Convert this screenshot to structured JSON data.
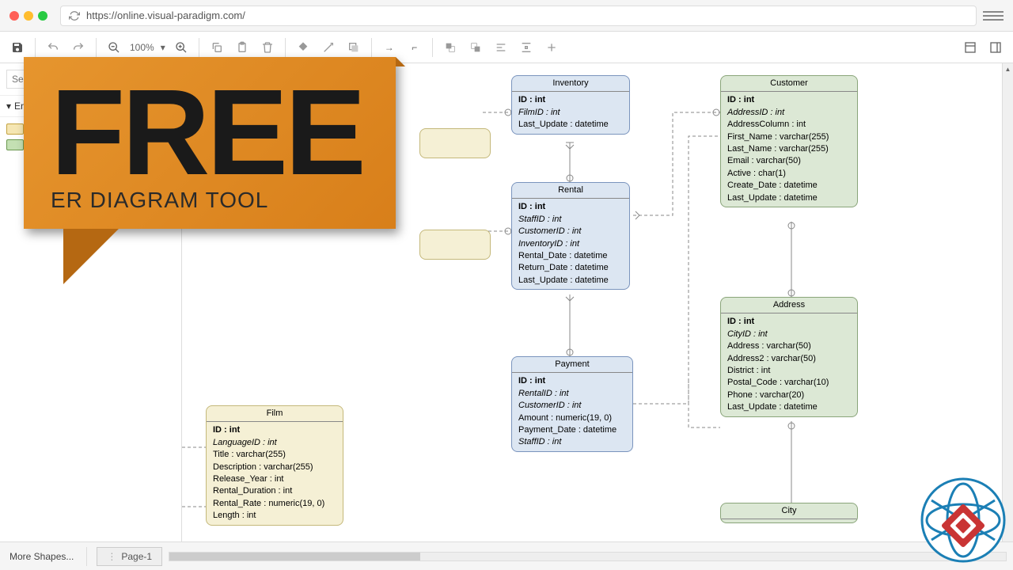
{
  "browser": {
    "url": "https://online.visual-paradigm.com/"
  },
  "toolbar": {
    "zoom": "100%"
  },
  "sidebar": {
    "search_placeholder": "Se",
    "section": "En",
    "more_shapes": "More Shapes..."
  },
  "page_tab": "Page-1",
  "banner": {
    "title": "FREE",
    "subtitle": "ER DIAGRAM TOOL"
  },
  "entities": {
    "inventory": {
      "title": "Inventory",
      "rows": [
        {
          "text": "ID : int",
          "pk": true
        },
        {
          "text": "FilmID : int",
          "fk": true
        },
        {
          "text": "Last_Update : datetime"
        }
      ]
    },
    "customer": {
      "title": "Customer",
      "rows": [
        {
          "text": "ID : int",
          "pk": true
        },
        {
          "text": "AddressID : int",
          "fk": true
        },
        {
          "text": "AddressColumn : int"
        },
        {
          "text": "First_Name : varchar(255)"
        },
        {
          "text": "Last_Name : varchar(255)"
        },
        {
          "text": "Email : varchar(50)"
        },
        {
          "text": "Active : char(1)"
        },
        {
          "text": "Create_Date : datetime"
        },
        {
          "text": "Last_Update : datetime"
        }
      ]
    },
    "rental": {
      "title": "Rental",
      "rows": [
        {
          "text": "ID : int",
          "pk": true
        },
        {
          "text": "StaffID : int",
          "fk": true
        },
        {
          "text": "CustomerID : int",
          "fk": true
        },
        {
          "text": "InventoryID : int",
          "fk": true
        },
        {
          "text": "Rental_Date : datetime"
        },
        {
          "text": "Return_Date : datetime"
        },
        {
          "text": "Last_Update : datetime"
        }
      ]
    },
    "address": {
      "title": "Address",
      "rows": [
        {
          "text": "ID : int",
          "pk": true
        },
        {
          "text": "CityID : int",
          "fk": true
        },
        {
          "text": "Address : varchar(50)"
        },
        {
          "text": "Address2 : varchar(50)"
        },
        {
          "text": "District : int"
        },
        {
          "text": "Postal_Code : varchar(10)"
        },
        {
          "text": "Phone : varchar(20)"
        },
        {
          "text": "Last_Update : datetime"
        }
      ]
    },
    "payment": {
      "title": "Payment",
      "rows": [
        {
          "text": "ID : int",
          "pk": true
        },
        {
          "text": "RentalID : int",
          "fk": true
        },
        {
          "text": "CustomerID : int",
          "fk": true
        },
        {
          "text": "Amount : numeric(19, 0)"
        },
        {
          "text": "Payment_Date : datetime"
        },
        {
          "text": "StaffID : int",
          "fk": true
        }
      ]
    },
    "film": {
      "title": "Film",
      "rows": [
        {
          "text": "ID : int",
          "pk": true
        },
        {
          "text": "LanguageID : int",
          "fk": true
        },
        {
          "text": "Title : varchar(255)"
        },
        {
          "text": "Description : varchar(255)"
        },
        {
          "text": "Release_Year : int"
        },
        {
          "text": "Rental_Duration : int"
        },
        {
          "text": "Rental_Rate : numeric(19, 0)"
        },
        {
          "text": "Length : int"
        }
      ]
    },
    "city": {
      "title": "City",
      "rows": []
    }
  }
}
